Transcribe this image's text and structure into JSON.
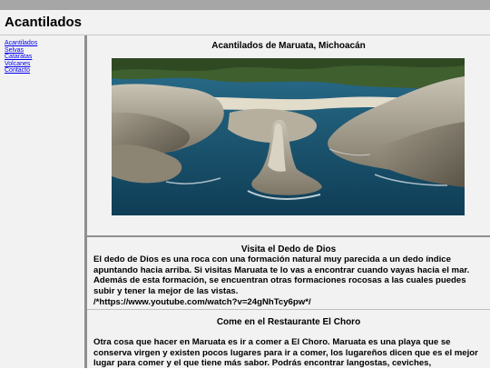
{
  "header": {
    "title": "Acantilados"
  },
  "sidebar": {
    "items": [
      {
        "label": "Acantilados"
      },
      {
        "label": "Selvas"
      },
      {
        "label": "Cataratas"
      },
      {
        "label": "Volcanes"
      },
      {
        "label": "Contacto"
      }
    ]
  },
  "main": {
    "section1": {
      "title": "Acantilados de Maruata, Michoacán"
    },
    "section2": {
      "title": "Visita el Dedo de Dios",
      "body": "El dedo de Dios es una roca con una formación natural muy parecida a un dedo índice apuntando hacia arriba. Si visitas Maruata te lo vas a encontrar cuando vayas hacia el mar. Además de esta formación, se encuentran otras formaciones rocosas a las cuales puedes subir y tener la mejor de las vistas.",
      "url": "/*https://www.youtube.com/watch?v=24gNhTcy6pw*/"
    },
    "section3": {
      "title": "Come en el Restaurante El Choro",
      "body": "Otra cosa que hacer en Maruata es ir a comer a El Choro. Maruata es una playa que se conserva virgen y existen pocos lugares para ir a comer, los lugareños dicen que es el mejor lugar para comer y el que tiene más sabor. Podrás encontrar langostas, ceviches,"
    }
  },
  "colors": {
    "page_bg": "#f2f2f2",
    "topbar": "#a6a6a6",
    "divider": "#8f8f8f",
    "link": "#0000ee"
  }
}
